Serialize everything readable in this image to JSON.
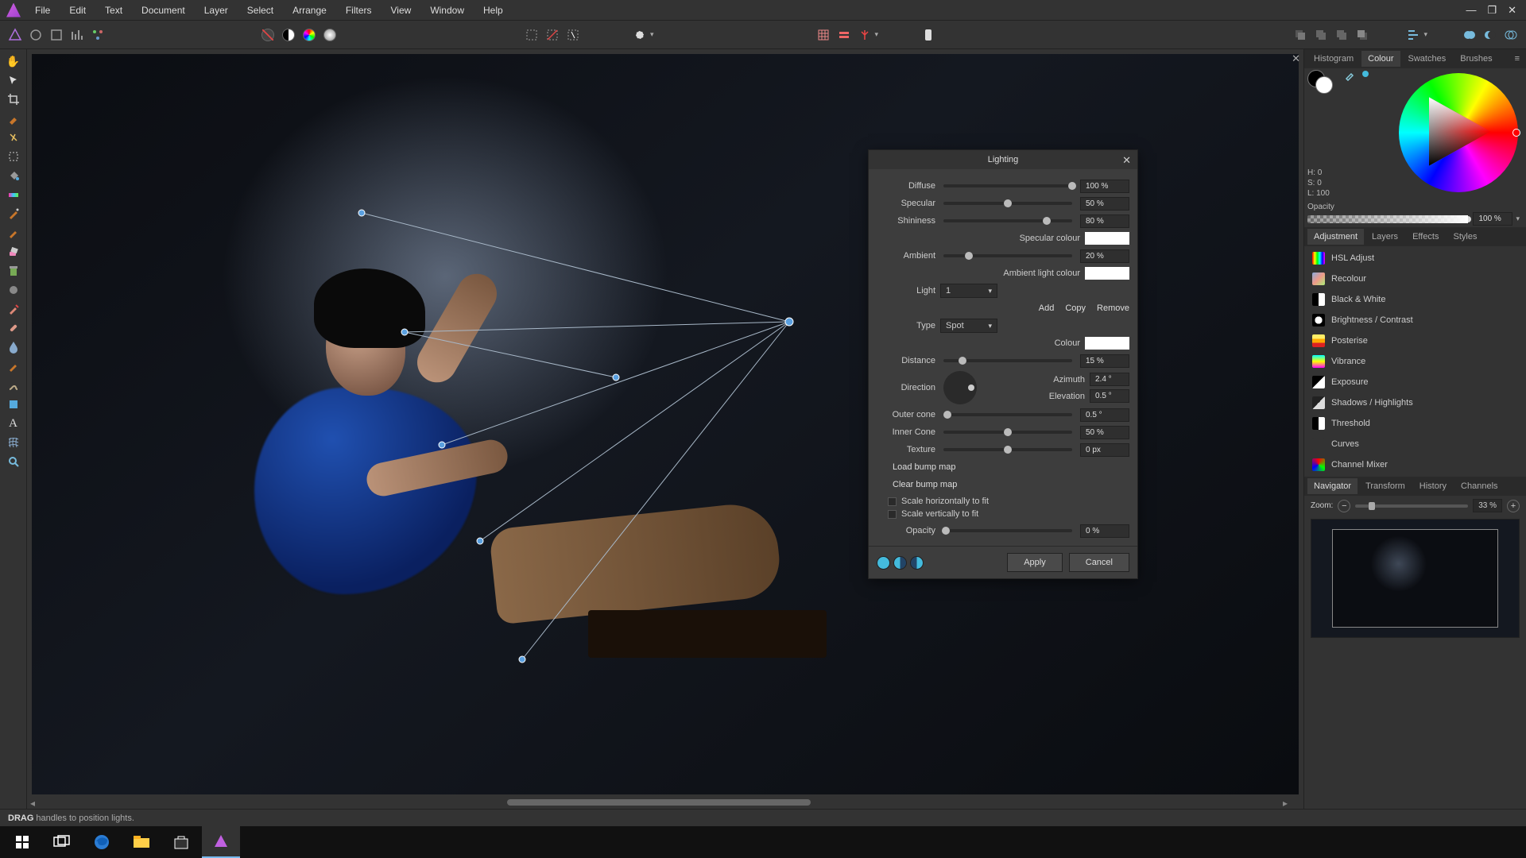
{
  "menu": {
    "items": [
      "File",
      "Edit",
      "Text",
      "Document",
      "Layer",
      "Select",
      "Arrange",
      "Filters",
      "View",
      "Window",
      "Help"
    ]
  },
  "colour_panel": {
    "tabs": [
      "Histogram",
      "Colour",
      "Swatches",
      "Brushes"
    ],
    "active_tab": 1,
    "hsl": {
      "h": "H: 0",
      "s": "S: 0",
      "l": "L: 100"
    },
    "opacity_label": "Opacity",
    "opacity_value": "100 %"
  },
  "adjustment_panel": {
    "tabs": [
      "Adjustment",
      "Layers",
      "Effects",
      "Styles"
    ],
    "items": [
      {
        "label": "HSL Adjust",
        "color": "linear-gradient(90deg,#f00,#ff0,#0f0,#0ff,#00f,#f0f)"
      },
      {
        "label": "Recolour",
        "color": "linear-gradient(135deg,#8ad,#e98,#ae7)"
      },
      {
        "label": "Black & White",
        "color": "linear-gradient(90deg,#000 50%,#fff 50%)"
      },
      {
        "label": "Brightness / Contrast",
        "color": "radial-gradient(circle,#fff 40%,#000 42%)"
      },
      {
        "label": "Posterise",
        "color": "linear-gradient(0deg,#d22 33%,#fa0 33% 66%,#fe6 66%)"
      },
      {
        "label": "Vibrance",
        "color": "linear-gradient(0deg,#f0f,#ff0,#0ff)"
      },
      {
        "label": "Exposure",
        "color": "linear-gradient(135deg,#000 50%,#fff 50%)"
      },
      {
        "label": "Shadows / Highlights",
        "color": "linear-gradient(135deg,#222 50%,#ddd 50%)"
      },
      {
        "label": "Threshold",
        "color": "linear-gradient(90deg,#000 50%,#fff 50%)"
      },
      {
        "label": "Curves",
        "color": "#333"
      },
      {
        "label": "Channel Mixer",
        "color": "conic-gradient(#f00,#0f0,#00f,#f00)"
      }
    ]
  },
  "nav_panel": {
    "tabs": [
      "Navigator",
      "Transform",
      "History",
      "Channels"
    ],
    "zoom_label": "Zoom:",
    "zoom_value": "33 %"
  },
  "dialog": {
    "title": "Lighting",
    "diffuse": {
      "label": "Diffuse",
      "value": "100 %",
      "pos": 100
    },
    "specular": {
      "label": "Specular",
      "value": "50 %",
      "pos": 50
    },
    "shininess": {
      "label": "Shininess",
      "value": "80 %",
      "pos": 80
    },
    "spec_colour_label": "Specular colour",
    "ambient": {
      "label": "Ambient",
      "value": "20 %",
      "pos": 20
    },
    "amb_colour_label": "Ambient light colour",
    "light_label": "Light",
    "light_value": "1",
    "actions": {
      "add": "Add",
      "copy": "Copy",
      "remove": "Remove"
    },
    "type_label": "Type",
    "type_value": "Spot",
    "colour_label": "Colour",
    "distance": {
      "label": "Distance",
      "value": "15 %",
      "pos": 15
    },
    "direction_label": "Direction",
    "azimuth": {
      "label": "Azimuth",
      "value": "2.4 °"
    },
    "elevation": {
      "label": "Elevation",
      "value": "0.5 °"
    },
    "outer": {
      "label": "Outer cone",
      "value": "0.5 °",
      "pos": 3
    },
    "inner": {
      "label": "Inner Cone",
      "value": "50 %",
      "pos": 50
    },
    "texture": {
      "label": "Texture",
      "value": "0 px",
      "pos": 50
    },
    "load_bump": "Load bump map",
    "clear_bump": "Clear bump map",
    "scale_h": "Scale horizontally to fit",
    "scale_v": "Scale vertically to fit",
    "opacity": {
      "label": "Opacity",
      "value": "0 %",
      "pos": 2
    },
    "apply": "Apply",
    "cancel": "Cancel"
  },
  "status": {
    "bold": "DRAG",
    "rest": "handles to position lights."
  }
}
